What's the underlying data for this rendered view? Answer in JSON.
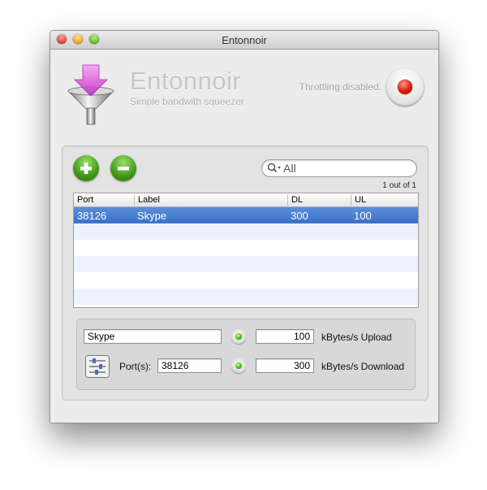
{
  "window": {
    "title": "Entonnoir"
  },
  "header": {
    "app_name": "Entonnoir",
    "subtitle": "Simple bandwith squeezer",
    "status": "Throttling disabled.",
    "toggle_icon": "record-icon",
    "logo_icon": "funnel-icon"
  },
  "toolbar": {
    "add_icon": "plus-icon",
    "remove_icon": "minus-icon",
    "search_value": "",
    "search_placeholder": "All",
    "result_count": "1 out of 1"
  },
  "table": {
    "columns": [
      "Port",
      "Label",
      "DL",
      "UL"
    ],
    "rows": [
      {
        "port": "38126",
        "label": "Skype",
        "dl": "300",
        "ul": "100",
        "selected": true
      }
    ]
  },
  "editor": {
    "label_value": "Skype",
    "ports_label": "Port(s):",
    "ports_value": "38126",
    "upload_value": "100",
    "upload_unit": "kBytes/s Upload",
    "download_value": "300",
    "download_unit": "kBytes/s Download",
    "prefs_icon": "sliders-icon"
  },
  "colors": {
    "selection": "#3a6fc8",
    "record": "#e0170a",
    "add_remove": "#3f9a16",
    "led": "#35b800"
  }
}
